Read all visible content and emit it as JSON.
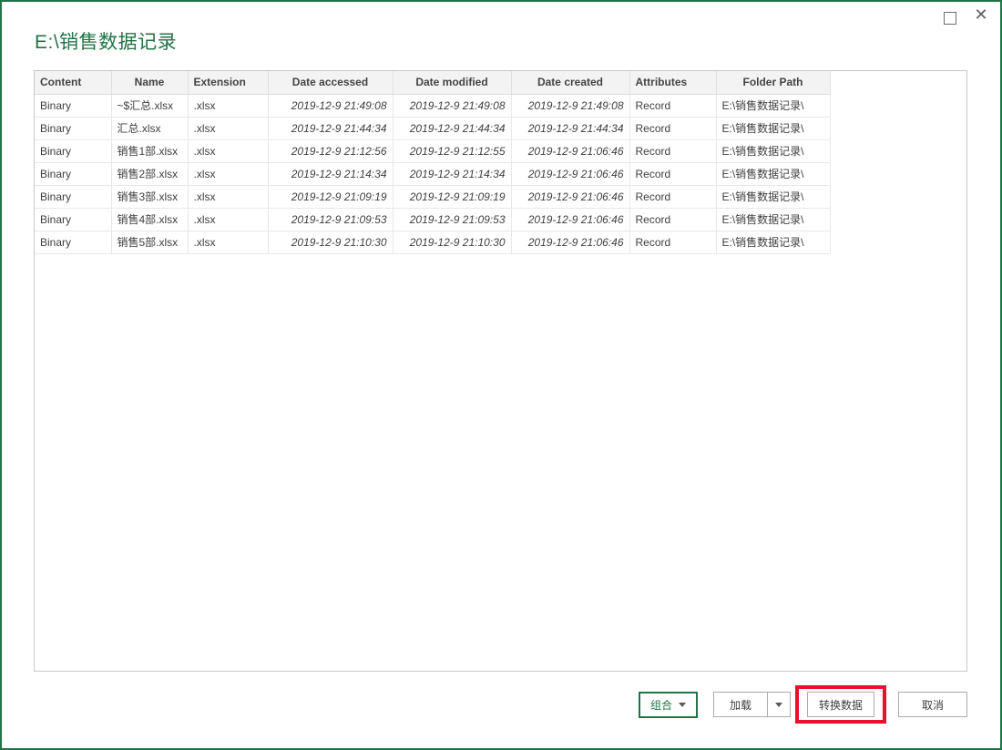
{
  "window": {
    "title": "E:\\销售数据记录",
    "accent_color": "#217346"
  },
  "window_controls": {
    "maximize_label": "maximize",
    "close_glyph": "✕"
  },
  "table": {
    "columns": [
      {
        "label": "Content"
      },
      {
        "label": "Name"
      },
      {
        "label": "Extension"
      },
      {
        "label": "Date accessed"
      },
      {
        "label": "Date modified"
      },
      {
        "label": "Date created"
      },
      {
        "label": "Attributes"
      },
      {
        "label": "Folder Path"
      }
    ],
    "rows": [
      [
        "Binary",
        "~$汇总.xlsx",
        ".xlsx",
        "2019-12-9 21:49:08",
        "2019-12-9 21:49:08",
        "2019-12-9 21:49:08",
        "Record",
        "E:\\销售数据记录\\"
      ],
      [
        "Binary",
        "汇总.xlsx",
        ".xlsx",
        "2019-12-9 21:44:34",
        "2019-12-9 21:44:34",
        "2019-12-9 21:44:34",
        "Record",
        "E:\\销售数据记录\\"
      ],
      [
        "Binary",
        "销售1部.xlsx",
        ".xlsx",
        "2019-12-9 21:12:56",
        "2019-12-9 21:12:55",
        "2019-12-9 21:06:46",
        "Record",
        "E:\\销售数据记录\\"
      ],
      [
        "Binary",
        "销售2部.xlsx",
        ".xlsx",
        "2019-12-9 21:14:34",
        "2019-12-9 21:14:34",
        "2019-12-9 21:06:46",
        "Record",
        "E:\\销售数据记录\\"
      ],
      [
        "Binary",
        "销售3部.xlsx",
        ".xlsx",
        "2019-12-9 21:09:19",
        "2019-12-9 21:09:19",
        "2019-12-9 21:06:46",
        "Record",
        "E:\\销售数据记录\\"
      ],
      [
        "Binary",
        "销售4部.xlsx",
        ".xlsx",
        "2019-12-9 21:09:53",
        "2019-12-9 21:09:53",
        "2019-12-9 21:06:46",
        "Record",
        "E:\\销售数据记录\\"
      ],
      [
        "Binary",
        "销售5部.xlsx",
        ".xlsx",
        "2019-12-9 21:10:30",
        "2019-12-9 21:10:30",
        "2019-12-9 21:06:46",
        "Record",
        "E:\\销售数据记录\\"
      ]
    ]
  },
  "footer": {
    "combine_label": "组合",
    "load_label": "加载",
    "transform_label": "转换数据",
    "cancel_label": "取消",
    "highlight_color": "#e8112d"
  }
}
